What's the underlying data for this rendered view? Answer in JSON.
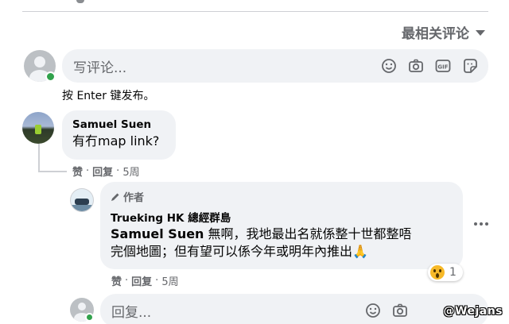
{
  "sort": {
    "label": "最相关评论"
  },
  "composer": {
    "placeholder": "写评论...",
    "hint": "按 Enter 键发布。",
    "tools": [
      "emoji-icon",
      "camera-icon",
      "gif-icon",
      "sticker-icon"
    ]
  },
  "comments": [
    {
      "author": "Samuel Suen",
      "text": "有冇map link?",
      "actions": {
        "like": "赞",
        "reply": "回复",
        "sep": "·",
        "time": "5周"
      }
    }
  ],
  "reply": {
    "author_badge": "作者",
    "author": "Trueking HK 總經群島",
    "mention": "Samuel Suen",
    "text_line1": " 無啊，我地最出名就係整十世都整唔",
    "text_line2": "完個地圖；但有望可以係今年或明年內推出🙏",
    "reaction_count": "1",
    "actions": {
      "like": "赞",
      "reply": "回复",
      "sep": "·",
      "time": "5周"
    }
  },
  "reply_composer": {
    "placeholder": "回复..."
  },
  "watermark": "@Wejans",
  "colors": {
    "bubble": "#f0f2f5",
    "muted": "#65676b",
    "online": "#31a24c"
  }
}
